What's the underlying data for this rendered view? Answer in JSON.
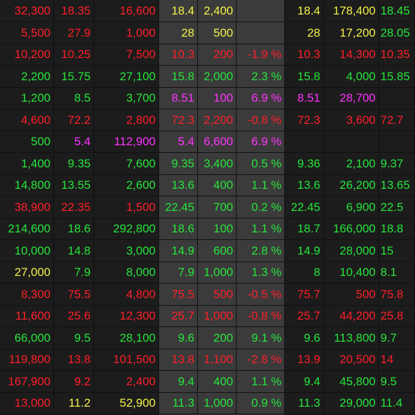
{
  "colors": {
    "red": "#ff1f2a",
    "green": "#27e53c",
    "yellow": "#f2f24a",
    "magenta": "#ff33ff",
    "background": "#1c1c1c",
    "highlight_band": "#3b3b3b"
  },
  "rows": [
    {
      "cells": [
        {
          "t": "32,300",
          "c": "red"
        },
        {
          "t": "18.35",
          "c": "red"
        },
        {
          "t": "16,600",
          "c": "red"
        },
        {
          "t": "18.4",
          "c": "yellow"
        },
        {
          "t": "2,400",
          "c": "yellow"
        },
        {
          "t": "",
          "c": "yellow"
        },
        {
          "t": "18.4",
          "c": "yellow"
        },
        {
          "t": "178,400",
          "c": "yellow"
        },
        {
          "t": "18.45",
          "c": "green"
        }
      ]
    },
    {
      "cells": [
        {
          "t": "5,500",
          "c": "red"
        },
        {
          "t": "27.9",
          "c": "red"
        },
        {
          "t": "1,000",
          "c": "red"
        },
        {
          "t": "28",
          "c": "yellow"
        },
        {
          "t": "500",
          "c": "yellow"
        },
        {
          "t": "",
          "c": "yellow"
        },
        {
          "t": "28",
          "c": "yellow"
        },
        {
          "t": "17,200",
          "c": "yellow"
        },
        {
          "t": "28.05",
          "c": "green"
        }
      ]
    },
    {
      "cells": [
        {
          "t": "10,200",
          "c": "red"
        },
        {
          "t": "10.25",
          "c": "red"
        },
        {
          "t": "7,500",
          "c": "red"
        },
        {
          "t": "10.3",
          "c": "red"
        },
        {
          "t": "200",
          "c": "red"
        },
        {
          "t": "-1.9 %",
          "c": "red"
        },
        {
          "t": "10.3",
          "c": "red"
        },
        {
          "t": "14,300",
          "c": "red"
        },
        {
          "t": "10.35",
          "c": "red"
        }
      ]
    },
    {
      "cells": [
        {
          "t": "2,200",
          "c": "green"
        },
        {
          "t": "15.75",
          "c": "green"
        },
        {
          "t": "27,100",
          "c": "green"
        },
        {
          "t": "15.8",
          "c": "green"
        },
        {
          "t": "2,000",
          "c": "green"
        },
        {
          "t": "2.3 %",
          "c": "green"
        },
        {
          "t": "15.8",
          "c": "green"
        },
        {
          "t": "4,000",
          "c": "green"
        },
        {
          "t": "15.85",
          "c": "green"
        }
      ]
    },
    {
      "cells": [
        {
          "t": "1,200",
          "c": "green"
        },
        {
          "t": "8.5",
          "c": "green"
        },
        {
          "t": "3,700",
          "c": "green"
        },
        {
          "t": "8.51",
          "c": "magenta"
        },
        {
          "t": "100",
          "c": "magenta"
        },
        {
          "t": "6.9 %",
          "c": "magenta"
        },
        {
          "t": "8.51",
          "c": "magenta"
        },
        {
          "t": "28,700",
          "c": "magenta"
        },
        {
          "t": "",
          "c": "green"
        }
      ]
    },
    {
      "cells": [
        {
          "t": "4,600",
          "c": "red"
        },
        {
          "t": "72.2",
          "c": "red"
        },
        {
          "t": "2,800",
          "c": "red"
        },
        {
          "t": "72.3",
          "c": "red"
        },
        {
          "t": "2,200",
          "c": "red"
        },
        {
          "t": "-0.8 %",
          "c": "red"
        },
        {
          "t": "72.3",
          "c": "red"
        },
        {
          "t": "3,600",
          "c": "red"
        },
        {
          "t": "72.7",
          "c": "red"
        }
      ]
    },
    {
      "cells": [
        {
          "t": "500",
          "c": "green"
        },
        {
          "t": "5.4",
          "c": "magenta"
        },
        {
          "t": "112,900",
          "c": "magenta"
        },
        {
          "t": "5.4",
          "c": "magenta"
        },
        {
          "t": "6,600",
          "c": "magenta"
        },
        {
          "t": "6.9 %",
          "c": "magenta"
        },
        {
          "t": "",
          "c": "green"
        },
        {
          "t": "",
          "c": "green"
        },
        {
          "t": "",
          "c": "green"
        }
      ]
    },
    {
      "cells": [
        {
          "t": "1,400",
          "c": "green"
        },
        {
          "t": "9.35",
          "c": "green"
        },
        {
          "t": "7,600",
          "c": "green"
        },
        {
          "t": "9.35",
          "c": "green"
        },
        {
          "t": "3,400",
          "c": "green"
        },
        {
          "t": "0.5 %",
          "c": "green"
        },
        {
          "t": "9.36",
          "c": "green"
        },
        {
          "t": "2,100",
          "c": "green"
        },
        {
          "t": "9.37",
          "c": "green"
        }
      ]
    },
    {
      "cells": [
        {
          "t": "14,800",
          "c": "green"
        },
        {
          "t": "13.55",
          "c": "green"
        },
        {
          "t": "2,600",
          "c": "green"
        },
        {
          "t": "13.6",
          "c": "green"
        },
        {
          "t": "400",
          "c": "green"
        },
        {
          "t": "1.1 %",
          "c": "green"
        },
        {
          "t": "13.6",
          "c": "green"
        },
        {
          "t": "26,200",
          "c": "green"
        },
        {
          "t": "13.65",
          "c": "green"
        }
      ]
    },
    {
      "cells": [
        {
          "t": "38,900",
          "c": "red"
        },
        {
          "t": "22.35",
          "c": "red"
        },
        {
          "t": "1,500",
          "c": "red"
        },
        {
          "t": "22.45",
          "c": "green"
        },
        {
          "t": "700",
          "c": "green"
        },
        {
          "t": "0.2 %",
          "c": "green"
        },
        {
          "t": "22.45",
          "c": "green"
        },
        {
          "t": "6,900",
          "c": "green"
        },
        {
          "t": "22.5",
          "c": "green"
        }
      ]
    },
    {
      "cells": [
        {
          "t": "214,600",
          "c": "green"
        },
        {
          "t": "18.6",
          "c": "green"
        },
        {
          "t": "292,800",
          "c": "green"
        },
        {
          "t": "18.6",
          "c": "green"
        },
        {
          "t": "100",
          "c": "green"
        },
        {
          "t": "1.1 %",
          "c": "green"
        },
        {
          "t": "18.7",
          "c": "green"
        },
        {
          "t": "166,000",
          "c": "green"
        },
        {
          "t": "18.8",
          "c": "green"
        }
      ]
    },
    {
      "cells": [
        {
          "t": "10,000",
          "c": "green"
        },
        {
          "t": "14.8",
          "c": "green"
        },
        {
          "t": "3,000",
          "c": "green"
        },
        {
          "t": "14.9",
          "c": "green"
        },
        {
          "t": "600",
          "c": "green"
        },
        {
          "t": "2.8 %",
          "c": "green"
        },
        {
          "t": "14.9",
          "c": "green"
        },
        {
          "t": "28,000",
          "c": "green"
        },
        {
          "t": "15",
          "c": "green"
        }
      ]
    },
    {
      "cells": [
        {
          "t": "27,000",
          "c": "yellow"
        },
        {
          "t": "7.9",
          "c": "green"
        },
        {
          "t": "8,000",
          "c": "green"
        },
        {
          "t": "7.9",
          "c": "green"
        },
        {
          "t": "1,000",
          "c": "green"
        },
        {
          "t": "1.3 %",
          "c": "green"
        },
        {
          "t": "8",
          "c": "green"
        },
        {
          "t": "10,400",
          "c": "green"
        },
        {
          "t": "8.1",
          "c": "green"
        }
      ]
    },
    {
      "cells": [
        {
          "t": "8,300",
          "c": "red"
        },
        {
          "t": "75.5",
          "c": "red"
        },
        {
          "t": "4,800",
          "c": "red"
        },
        {
          "t": "75.5",
          "c": "red"
        },
        {
          "t": "500",
          "c": "red"
        },
        {
          "t": "-0.5 %",
          "c": "red"
        },
        {
          "t": "75.7",
          "c": "red"
        },
        {
          "t": "500",
          "c": "red"
        },
        {
          "t": "75.8",
          "c": "red"
        }
      ]
    },
    {
      "cells": [
        {
          "t": "11,600",
          "c": "red"
        },
        {
          "t": "25.6",
          "c": "red"
        },
        {
          "t": "12,300",
          "c": "red"
        },
        {
          "t": "25.7",
          "c": "red"
        },
        {
          "t": "1,000",
          "c": "red"
        },
        {
          "t": "-0.8 %",
          "c": "red"
        },
        {
          "t": "25.7",
          "c": "red"
        },
        {
          "t": "44,200",
          "c": "red"
        },
        {
          "t": "25.8",
          "c": "red"
        }
      ]
    },
    {
      "cells": [
        {
          "t": "66,000",
          "c": "green"
        },
        {
          "t": "9.5",
          "c": "green"
        },
        {
          "t": "28,100",
          "c": "green"
        },
        {
          "t": "9.6",
          "c": "green"
        },
        {
          "t": "200",
          "c": "green"
        },
        {
          "t": "9.1 %",
          "c": "green"
        },
        {
          "t": "9.6",
          "c": "green"
        },
        {
          "t": "113,800",
          "c": "green"
        },
        {
          "t": "9.7",
          "c": "green"
        }
      ]
    },
    {
      "cells": [
        {
          "t": "119,800",
          "c": "red"
        },
        {
          "t": "13.8",
          "c": "red"
        },
        {
          "t": "101,500",
          "c": "red"
        },
        {
          "t": "13.8",
          "c": "red"
        },
        {
          "t": "1,100",
          "c": "red"
        },
        {
          "t": "-2.8 %",
          "c": "red"
        },
        {
          "t": "13.9",
          "c": "red"
        },
        {
          "t": "20,500",
          "c": "red"
        },
        {
          "t": "14",
          "c": "red"
        }
      ]
    },
    {
      "cells": [
        {
          "t": "167,900",
          "c": "red"
        },
        {
          "t": "9.2",
          "c": "red"
        },
        {
          "t": "2,400",
          "c": "red"
        },
        {
          "t": "9.4",
          "c": "green"
        },
        {
          "t": "400",
          "c": "green"
        },
        {
          "t": "1.1 %",
          "c": "green"
        },
        {
          "t": "9.4",
          "c": "green"
        },
        {
          "t": "45,800",
          "c": "green"
        },
        {
          "t": "9.5",
          "c": "green"
        }
      ]
    },
    {
      "cells": [
        {
          "t": "13,000",
          "c": "red"
        },
        {
          "t": "11.2",
          "c": "yellow"
        },
        {
          "t": "52,900",
          "c": "yellow"
        },
        {
          "t": "11.3",
          "c": "green"
        },
        {
          "t": "1,000",
          "c": "green"
        },
        {
          "t": "0.9 %",
          "c": "green"
        },
        {
          "t": "11.3",
          "c": "green"
        },
        {
          "t": "29,000",
          "c": "green"
        },
        {
          "t": "11.4",
          "c": "green"
        }
      ]
    }
  ]
}
